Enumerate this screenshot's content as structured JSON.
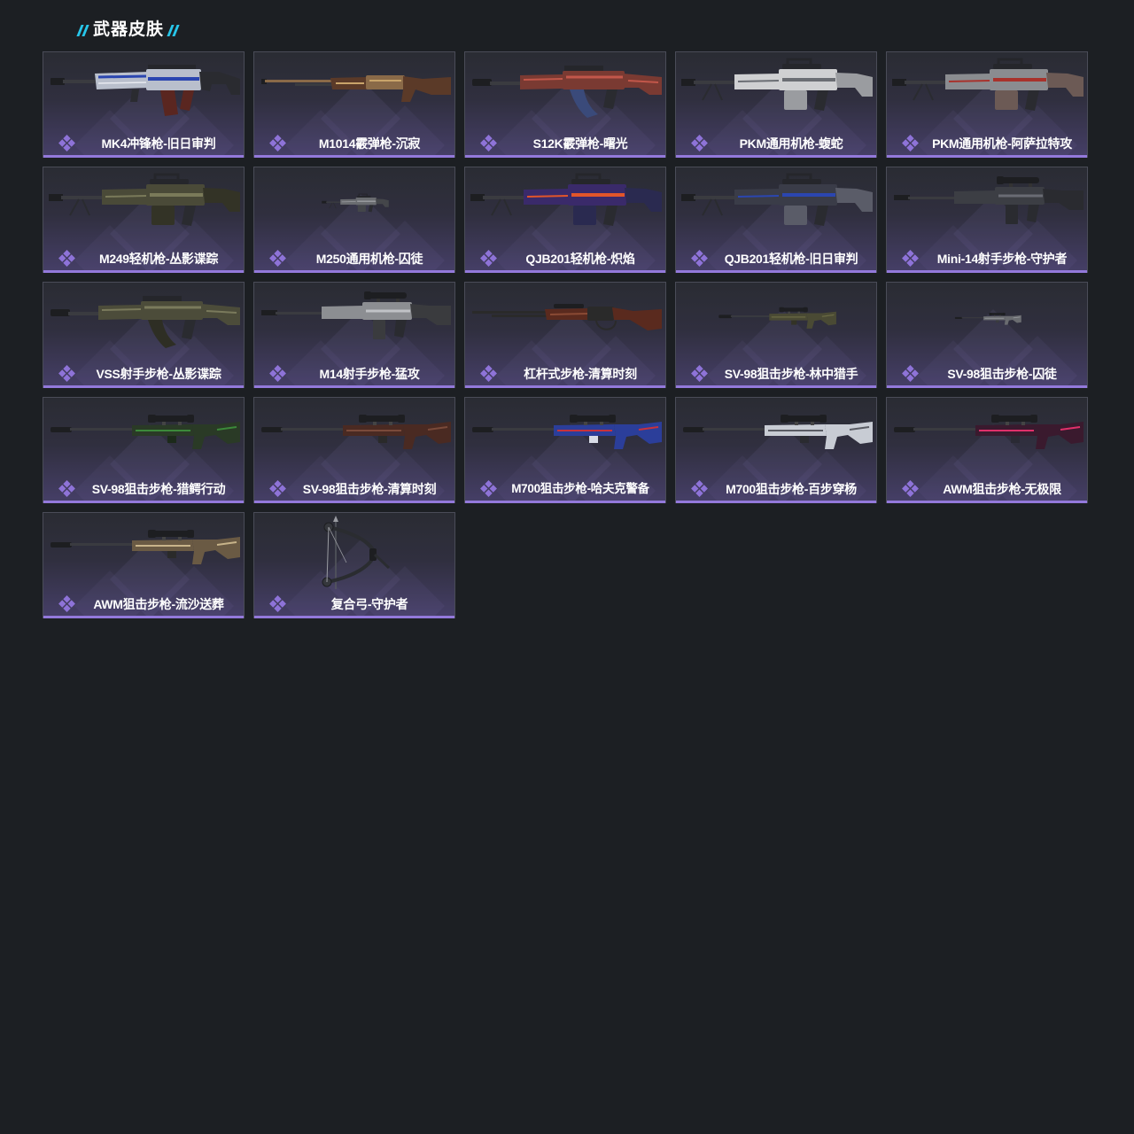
{
  "section": {
    "title": "武器皮肤"
  },
  "colors": {
    "page_background": "#1c1f23",
    "title_slash": "#27c6ea",
    "rarity_purple": "#9379db",
    "badge_purple": "#8e73d8"
  },
  "cards": [
    {
      "label": "MK4冲锋枪-旧日审判",
      "icon": "smg-icon",
      "colors": [
        "#b9bfcc",
        "#2b46b0",
        "#5a2620"
      ]
    },
    {
      "label": "M1014霰弹枪-沉寂",
      "icon": "shotgun-icon",
      "colors": [
        "#8a6a48",
        "#c9a46a",
        "#5b3a28"
      ]
    },
    {
      "label": "S12K霰弹枪-曙光",
      "icon": "box-mag-shotgun-icon",
      "colors": [
        "#7a3a32",
        "#c2574a",
        "#3a4a7a"
      ]
    },
    {
      "label": "PKM通用机枪-蝮蛇",
      "icon": "machine-gun-icon",
      "colors": [
        "#cfd0d2",
        "#6b6e74",
        "#9a9ca0"
      ]
    },
    {
      "label": "PKM通用机枪-阿萨拉特攻",
      "icon": "machine-gun-icon",
      "colors": [
        "#8a8c90",
        "#a8322c",
        "#6c5a55"
      ]
    },
    {
      "label": "M249轻机枪-丛影谍踪",
      "icon": "machine-gun-icon",
      "colors": [
        "#4a4a38",
        "#7a7a5a",
        "#333326"
      ]
    },
    {
      "label": "M250通用机枪-囚徒",
      "icon": "machine-gun-icon",
      "colors": [
        "#6a6c70",
        "#9c9ea2",
        "#44464a"
      ]
    },
    {
      "label": "QJB201轻机枪-炽焰",
      "icon": "machine-gun-icon",
      "colors": [
        "#3a2a6a",
        "#e2552a",
        "#2a2a50"
      ]
    },
    {
      "label": "QJB201轻机枪-旧日审判",
      "icon": "machine-gun-icon",
      "colors": [
        "#3a3c48",
        "#2b46b0",
        "#5a5c68"
      ]
    },
    {
      "label": "Mini-14射手步枪-守护者",
      "icon": "marksman-rifle-icon",
      "colors": [
        "#3c3e44",
        "#6a6c74",
        "#2a2b30"
      ]
    },
    {
      "label": "VSS射手步枪-丛影谍踪",
      "icon": "suppressed-rifle-icon",
      "colors": [
        "#4c4c3a",
        "#7a7a5c",
        "#2e2e24"
      ]
    },
    {
      "label": "M14射手步枪-猛攻",
      "icon": "marksman-rifle-icon",
      "colors": [
        "#8c8e92",
        "#c0c2c6",
        "#3a3b3e"
      ]
    },
    {
      "label": "杠杆式步枪-清算时刻",
      "icon": "lever-action-rifle-icon",
      "colors": [
        "#5a2a1e",
        "#8a4a34",
        "#2a2a2a"
      ]
    },
    {
      "label": "SV-98狙击步枪-林中猎手",
      "icon": "sniper-rifle-icon",
      "colors": [
        "#4a4a34",
        "#6a6a44",
        "#333326"
      ]
    },
    {
      "label": "SV-98狙击步枪-囚徒",
      "icon": "sniper-rifle-icon",
      "colors": [
        "#6a6c70",
        "#9a9ca0",
        "#3a3b3e"
      ]
    },
    {
      "label": "SV-98狙击步枪-猎鳄行动",
      "icon": "sniper-rifle-icon",
      "colors": [
        "#2a3a26",
        "#3c8a3a",
        "#1c2a1a"
      ]
    },
    {
      "label": "SV-98狙击步枪-清算时刻",
      "icon": "sniper-rifle-icon",
      "colors": [
        "#4a2a22",
        "#7a4a3a",
        "#2a2a2a"
      ]
    },
    {
      "label": "M700狙击步枪-哈夫克警备",
      "icon": "sniper-rifle-icon",
      "colors": [
        "#2b3e9a",
        "#c8323c",
        "#d8dce6"
      ]
    },
    {
      "label": "M700狙击步枪-百步穿杨",
      "icon": "sniper-rifle-icon",
      "colors": [
        "#c8ccd4",
        "#5a5c64",
        "#2a2b30"
      ]
    },
    {
      "label": "AWM狙击步枪-无极限",
      "icon": "sniper-rifle-icon",
      "colors": [
        "#3a1a2e",
        "#e0306a",
        "#2a2a34"
      ]
    },
    {
      "label": "AWM狙击步枪-流沙送葬",
      "icon": "sniper-rifle-icon",
      "colors": [
        "#6a5a44",
        "#c8b48a",
        "#2a2a2a"
      ]
    },
    {
      "label": "复合弓-守护者",
      "icon": "compound-bow-icon",
      "colors": [
        "#2a2c30",
        "#55585e",
        "#9a9ca2"
      ]
    }
  ]
}
